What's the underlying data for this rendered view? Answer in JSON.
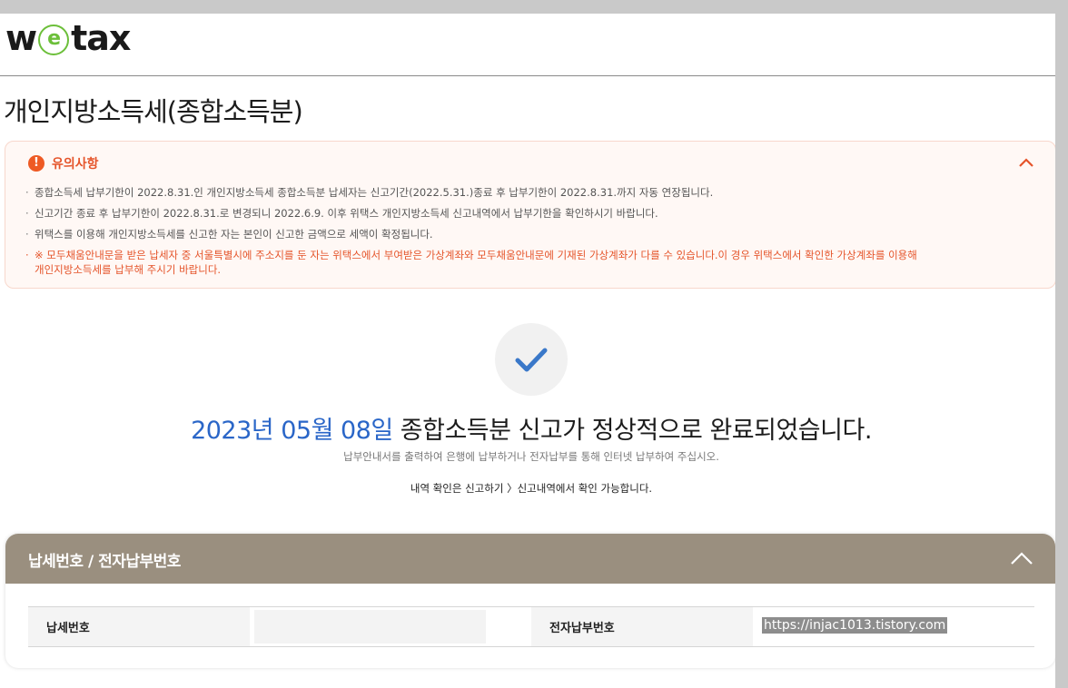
{
  "logo": {
    "prefix": "w",
    "e": "e",
    "suffix": "tax"
  },
  "page_title": "개인지방소득세(종합소득분)",
  "notice": {
    "title": "유의사항",
    "icon": "exclamation-icon",
    "items": [
      "종합소득세 납부기한이 2022.8.31.인 개인지방소득세 종합소득분 납세자는 신고기간(2022.5.31.)종료 후 납부기한이 2022.8.31.까지 자동 연장됩니다.",
      "신고기간 종료 후 납부기한이 2022.8.31.로 변경되니 2022.6.9. 이후 위택스 개인지방소득세 신고내역에서 납부기한을 확인하시기 바랍니다.",
      "위택스를 이용해 개인지방소득세를 신고한 자는 본인이 신고한 금액으로 세액이 확정됩니다."
    ],
    "warning_line1": "※ 모두채움안내문을 받은 납세자 중 서울특별시에 주소지를 둔 자는 위택스에서 부여받은 가상계좌와 모두채움안내문에 기재된 가상계좌가 다를 수 있습니다.이 경우 위택스에서 확인한 가상계좌를 이용해",
    "warning_line2": "개인지방소득세를 납부해 주시기 바랍니다."
  },
  "completion": {
    "date": "2023년 05월 08일",
    "message": " 종합소득분 신고가 정상적으로 완료되었습니다.",
    "sub1": "납부안내서를 출력하여 은행에 납부하거나 전자납부를 통해 인터넷 납부하여 주십시오.",
    "sub2": "내역 확인은 신고하기 〉신고내역에서 확인 가능합니다."
  },
  "tax_panel": {
    "title": "납세번호 / 전자납부번호",
    "tax_number_label": "납세번호",
    "epay_number_label": "전자납부번호",
    "watermark": "https://injac1013.tistory.com"
  },
  "colors": {
    "accent_blue": "#2a66c8",
    "warning_orange": "#e5542a",
    "panel_header": "#9a8f7f",
    "check_blue": "#3a78c9"
  }
}
